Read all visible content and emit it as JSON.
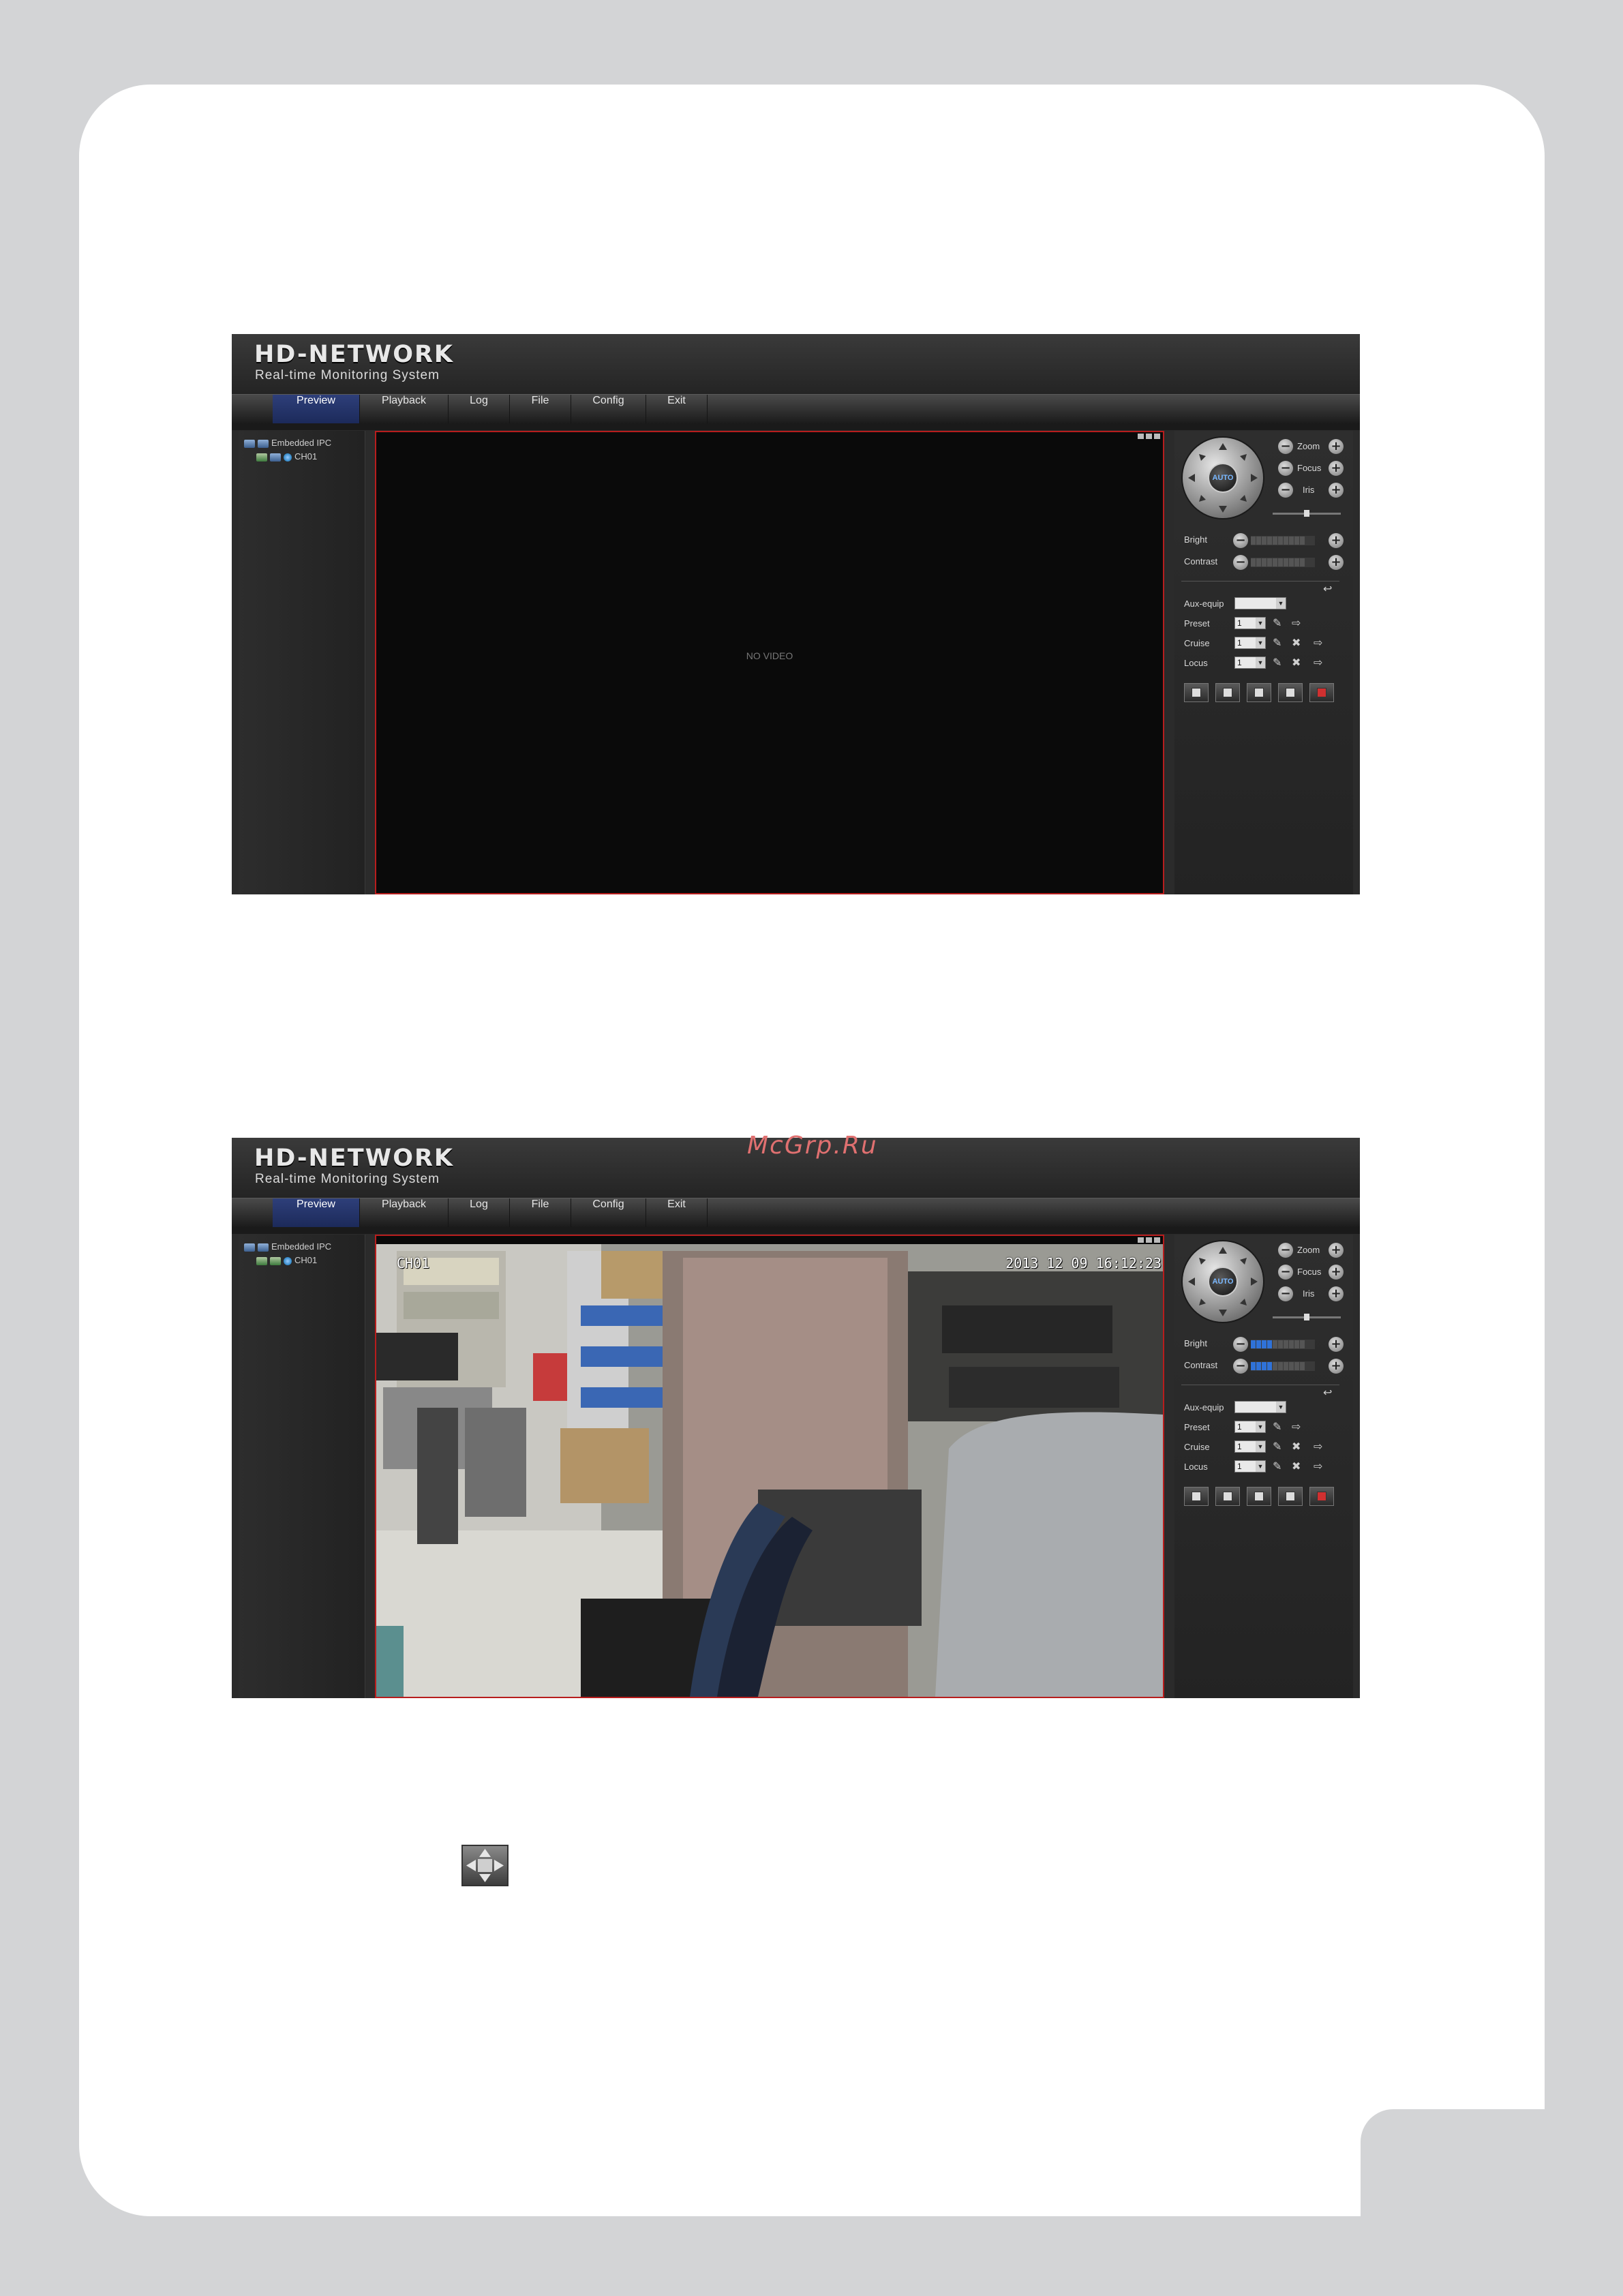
{
  "watermark": "McGrp.Ru",
  "screens": [
    {
      "header": {
        "logo": "HD-NETWORK",
        "subtitle": "Real-time Monitoring System"
      },
      "nav": {
        "tabs": [
          "Preview",
          "Playback",
          "Log",
          "File",
          "Config",
          "Exit"
        ],
        "active": "Preview"
      },
      "tree": {
        "root": "Embedded IPC",
        "channel": "CH01"
      },
      "video": {
        "status": "NO VIDEO",
        "osd_channel": "",
        "osd_timestamp": ""
      },
      "ptz": {
        "center": "AUTO",
        "controls": [
          "Zoom",
          "Focus",
          "Iris"
        ]
      },
      "image": {
        "bright_label": "Bright",
        "contrast_label": "Contrast",
        "bright_level": 0,
        "contrast_level": 0
      },
      "aux": {
        "aux_label": "Aux-equip",
        "aux_value": "",
        "preset_label": "Preset",
        "preset_value": "1",
        "cruise_label": "Cruise",
        "cruise_value": "1",
        "locus_label": "Locus",
        "locus_value": "1"
      }
    },
    {
      "header": {
        "logo": "HD-NETWORK",
        "subtitle": "Real-time Monitoring System"
      },
      "nav": {
        "tabs": [
          "Preview",
          "Playback",
          "Log",
          "File",
          "Config",
          "Exit"
        ],
        "active": "Preview"
      },
      "tree": {
        "root": "Embedded IPC",
        "channel": "CH01"
      },
      "video": {
        "status": "",
        "osd_channel": "CH01",
        "osd_timestamp": "2013 12 09 16:12:23"
      },
      "ptz": {
        "center": "AUTO",
        "controls": [
          "Zoom",
          "Focus",
          "Iris"
        ]
      },
      "image": {
        "bright_label": "Bright",
        "contrast_label": "Contrast",
        "bright_level": 0.4,
        "contrast_level": 0.4
      },
      "aux": {
        "aux_label": "Aux-equip",
        "aux_value": "",
        "preset_label": "Preset",
        "preset_value": "1",
        "cruise_label": "Cruise",
        "cruise_value": "1",
        "locus_label": "Locus",
        "locus_value": "1"
      }
    }
  ],
  "icons": {
    "ptz_move_icon": "four-way-arrow-icon"
  }
}
